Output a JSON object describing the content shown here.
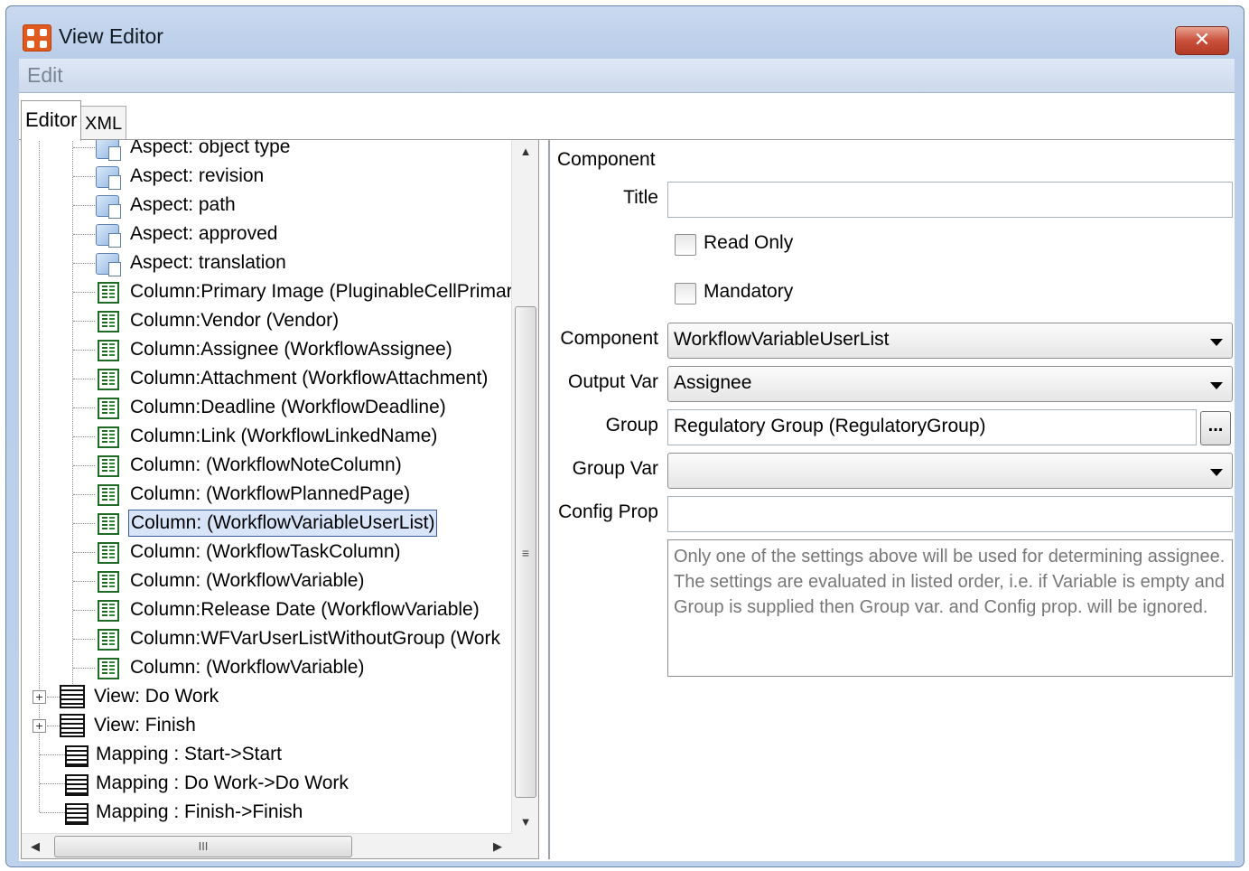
{
  "window": {
    "title": "View Editor",
    "close_label": "✕"
  },
  "menu": {
    "items": [
      "Edit"
    ]
  },
  "tabs": [
    {
      "label": "Editor",
      "active": true
    },
    {
      "label": "XML",
      "active": false
    }
  ],
  "tree": {
    "aspects": [
      "Aspect: object type",
      "Aspect: revision",
      "Aspect: path",
      "Aspect: approved",
      "Aspect: translation"
    ],
    "columns": [
      "Column:Primary Image (PluginableCellPrimar",
      "Column:Vendor (Vendor)",
      "Column:Assignee (WorkflowAssignee)",
      "Column:Attachment (WorkflowAttachment)",
      "Column:Deadline (WorkflowDeadline)",
      "Column:Link (WorkflowLinkedName)",
      "Column: (WorkflowNoteColumn)",
      "Column: (WorkflowPlannedPage)",
      "Column: (WorkflowVariableUserList)",
      "Column: (WorkflowTaskColumn)",
      "Column: (WorkflowVariable)",
      "Column:Release Date (WorkflowVariable)",
      "Column:WFVarUserListWithoutGroup (Work",
      "Column: (WorkflowVariable)"
    ],
    "selected_column_index": 8,
    "views": [
      "View: Do Work",
      "View: Finish"
    ],
    "mappings": [
      "Mapping : Start->Start",
      "Mapping : Do Work->Do Work",
      "Mapping : Finish->Finish"
    ],
    "expand_symbol": "+",
    "hscroll_grip": "III",
    "vscroll_grip": "≡"
  },
  "form": {
    "section_title": "Component",
    "title_label": "Title",
    "title_value": "",
    "read_only_label": "Read Only",
    "read_only_checked": false,
    "mandatory_label": "Mandatory",
    "mandatory_checked": false,
    "component_label": "Component",
    "component_value": "WorkflowVariableUserList",
    "output_var_label": "Output Var",
    "output_var_value": "Assignee",
    "group_label": "Group",
    "group_value": "Regulatory Group (RegulatoryGroup)",
    "group_browse_label": "...",
    "group_var_label": "Group Var",
    "group_var_value": "",
    "config_prop_label": "Config Prop",
    "config_prop_value": "",
    "note": "Only one of the settings above will be used  for determining assignee. The settings are evaluated in listed order, i.e. if Variable is empty and Group is supplied then Group var. and Config prop. will be ignored."
  },
  "colors": {
    "title_bar": "#c9d9ef",
    "close_button": "#c9503a",
    "selection_fill": "#d8e4f8",
    "selection_border": "#3c5a9a",
    "column_icon": "#1f6b25"
  }
}
